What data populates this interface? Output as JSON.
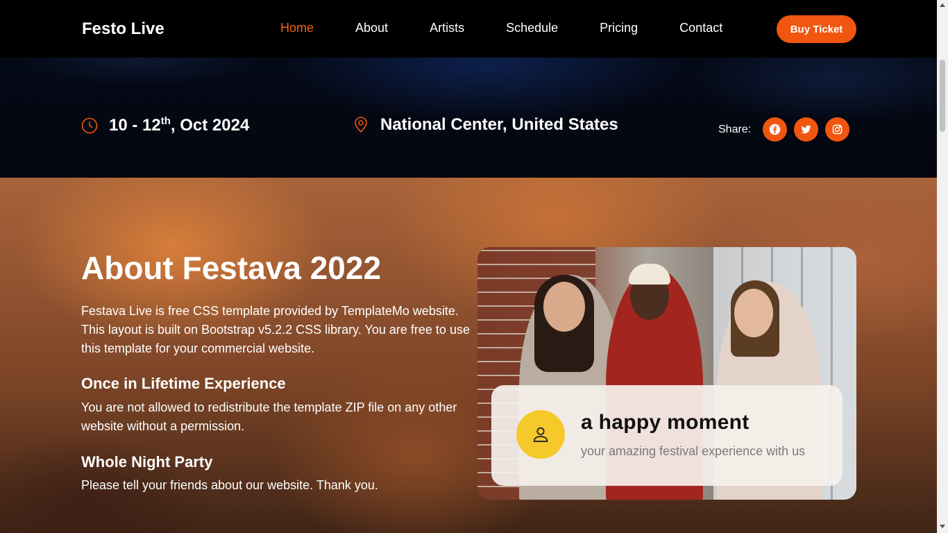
{
  "navbar": {
    "brand": "Festo Live",
    "links": [
      {
        "label": "Home",
        "active": true
      },
      {
        "label": "About",
        "active": false
      },
      {
        "label": "Artists",
        "active": false
      },
      {
        "label": "Schedule",
        "active": false
      },
      {
        "label": "Pricing",
        "active": false
      },
      {
        "label": "Contact",
        "active": false
      }
    ],
    "cta_label": "Buy Ticket"
  },
  "event_info": {
    "date_prefix": "10 - 12",
    "date_sup": "th",
    "date_suffix": ", Oct 2024",
    "location": "National Center, United States",
    "date_icon": "clock-icon",
    "location_icon": "map-pin-icon"
  },
  "share": {
    "label": "Share:",
    "networks": [
      "facebook-icon",
      "twitter-icon",
      "instagram-icon"
    ]
  },
  "about": {
    "title": "About Festava 2022",
    "intro": "Festava Live is free CSS template provided by TemplateMo website. This layout is built on Bootstrap v5.2.2 CSS library. You are free to use this template for your commercial website.",
    "heading_1": "Once in Lifetime Experience",
    "text_1": "You are not allowed to redistribute the template ZIP file on any other website without a permission.",
    "heading_2": "Whole Night Party",
    "text_2": "Please tell your friends about our website. Thank you."
  },
  "moment_card": {
    "title": "a happy moment",
    "subtitle": "your amazing festival experience with us",
    "avatar_icon": "person-icon"
  },
  "colors": {
    "accent": "#f0560f",
    "nav_active": "#f65d13",
    "avatar_bg": "#f5c92a",
    "navbar_bg": "#000000"
  }
}
